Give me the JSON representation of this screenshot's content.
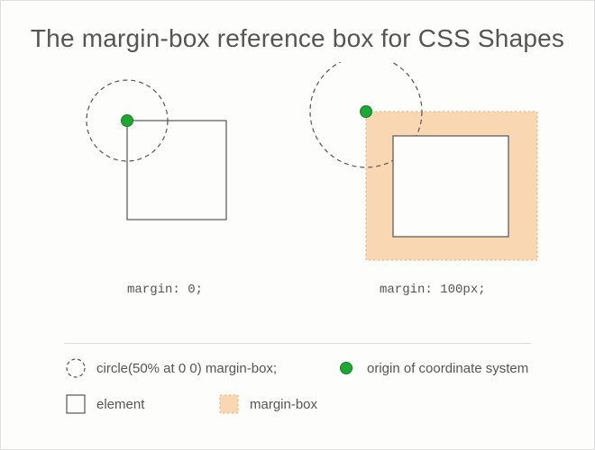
{
  "title": "The margin-box reference box for CSS Shapes",
  "diagrams": {
    "left": {
      "caption": "margin: 0;"
    },
    "right": {
      "caption": "margin: 100px;"
    }
  },
  "legend": {
    "shape": "circle(50% at 0 0) margin-box;",
    "origin": "origin of coordinate system",
    "element": "element",
    "marginBox": "margin-box"
  },
  "colors": {
    "marginBoxFill": "#f9d7b2",
    "marginBoxStroke": "#e9b783",
    "originFill": "#1ea832",
    "elementStroke": "#555555"
  }
}
